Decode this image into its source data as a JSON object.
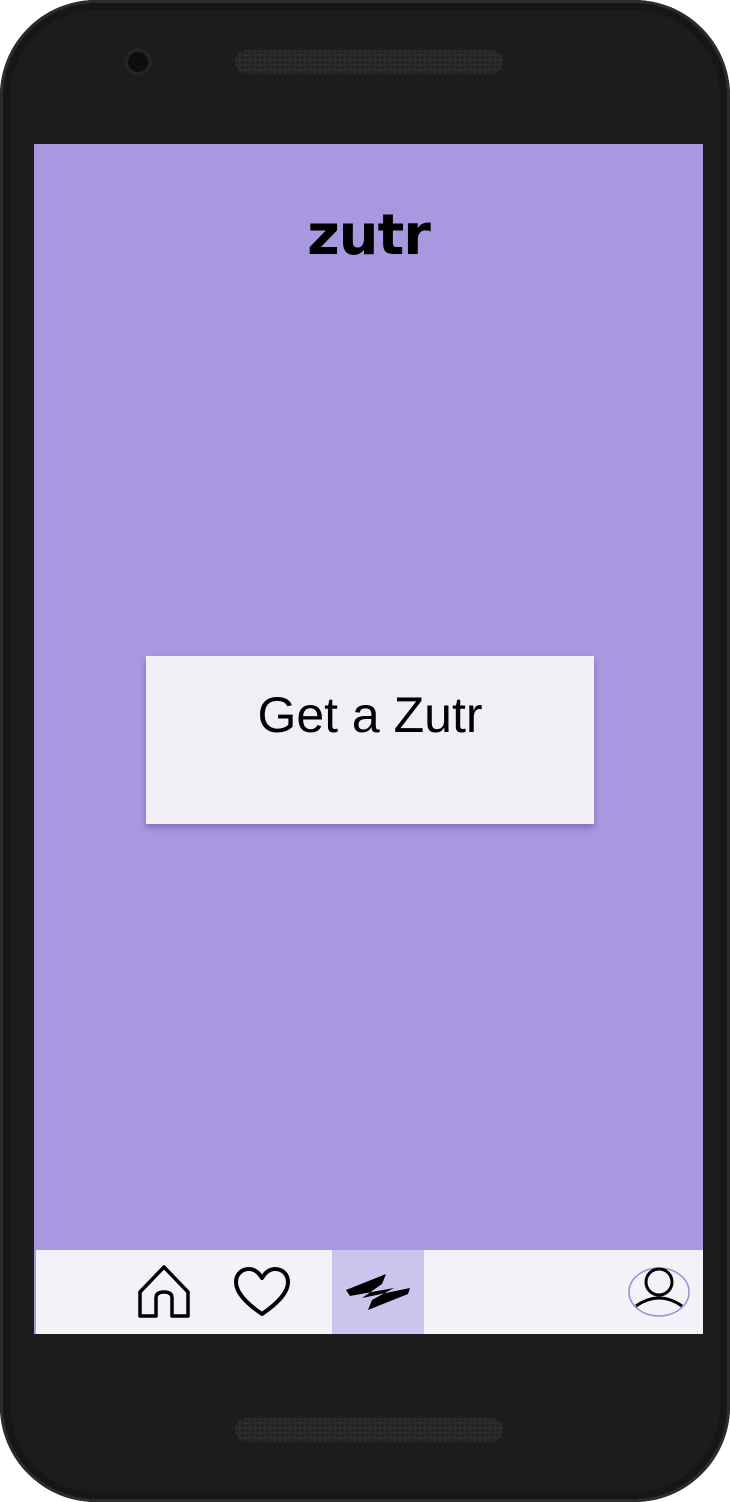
{
  "app": {
    "title": "zutr",
    "background_color": "#a898df"
  },
  "main": {
    "cta_label": "Get a Zutr"
  },
  "bottom_nav": {
    "items": [
      {
        "id": "home",
        "icon": "home-icon",
        "active": false
      },
      {
        "id": "favorites",
        "icon": "heart-icon",
        "active": false
      },
      {
        "id": "zutr",
        "icon": "zutr-logo-icon",
        "active": true
      },
      {
        "id": "profile",
        "icon": "user-avatar-icon",
        "active": false
      }
    ],
    "active_color": "#cdc4ed",
    "background_color": "#f3f2f8"
  }
}
